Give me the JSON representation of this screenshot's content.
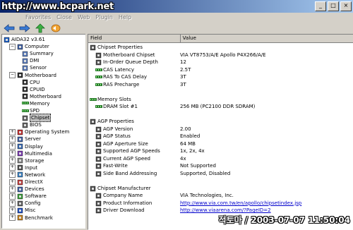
{
  "watermark": "http://www.bcpark.net",
  "menu": [
    "Sc",
    "Favorites",
    "Close",
    "Web",
    "Plugin",
    "Help"
  ],
  "tree": [
    {
      "label": "AIDA32 v3.61",
      "indent": 0,
      "exp": "",
      "icon": "app-icon"
    },
    {
      "label": "Computer",
      "indent": 1,
      "exp": "−",
      "icon": "computer-icon"
    },
    {
      "label": "Summary",
      "indent": 2,
      "exp": "",
      "icon": "summary-icon"
    },
    {
      "label": "DMI",
      "indent": 2,
      "exp": "",
      "icon": "dmi-icon"
    },
    {
      "label": "Sensor",
      "indent": 2,
      "exp": "",
      "icon": "sensor-icon"
    },
    {
      "label": "Motherboard",
      "indent": 1,
      "exp": "−",
      "icon": "motherboard-icon"
    },
    {
      "label": "CPU",
      "indent": 2,
      "exp": "",
      "icon": "cpu-icon"
    },
    {
      "label": "CPUID",
      "indent": 2,
      "exp": "",
      "icon": "cpuid-icon"
    },
    {
      "label": "Motherboard",
      "indent": 2,
      "exp": "",
      "icon": "board-icon"
    },
    {
      "label": "Memory",
      "indent": 2,
      "exp": "",
      "icon": "memory-icon"
    },
    {
      "label": "SPD",
      "indent": 2,
      "exp": "",
      "icon": "spd-icon"
    },
    {
      "label": "Chipset",
      "indent": 2,
      "exp": "",
      "icon": "chipset-icon",
      "selected": true
    },
    {
      "label": "BIOS",
      "indent": 2,
      "exp": "",
      "icon": "bios-icon"
    },
    {
      "label": "Operating System",
      "indent": 1,
      "exp": "+",
      "icon": "os-icon"
    },
    {
      "label": "Server",
      "indent": 1,
      "exp": "+",
      "icon": "server-icon"
    },
    {
      "label": "Display",
      "indent": 1,
      "exp": "+",
      "icon": "display-icon"
    },
    {
      "label": "Multimedia",
      "indent": 1,
      "exp": "+",
      "icon": "multimedia-icon"
    },
    {
      "label": "Storage",
      "indent": 1,
      "exp": "+",
      "icon": "storage-icon"
    },
    {
      "label": "Input",
      "indent": 1,
      "exp": "+",
      "icon": "input-icon"
    },
    {
      "label": "Network",
      "indent": 1,
      "exp": "+",
      "icon": "network-icon"
    },
    {
      "label": "DirectX",
      "indent": 1,
      "exp": "+",
      "icon": "directx-icon"
    },
    {
      "label": "Devices",
      "indent": 1,
      "exp": "+",
      "icon": "devices-icon"
    },
    {
      "label": "Software",
      "indent": 1,
      "exp": "+",
      "icon": "software-icon"
    },
    {
      "label": "Config",
      "indent": 1,
      "exp": "+",
      "icon": "config-icon"
    },
    {
      "label": "Misc",
      "indent": 1,
      "exp": "+",
      "icon": "misc-icon"
    },
    {
      "label": "Benchmark",
      "indent": 1,
      "exp": "+",
      "icon": "benchmark-icon"
    }
  ],
  "columns": {
    "field": "Field",
    "value": "Value"
  },
  "rows": [
    {
      "type": "group",
      "field": "Chipset Properties",
      "value": "",
      "icon": "chipset-group-icon"
    },
    {
      "type": "item",
      "field": "Motherboard Chipset",
      "value": "VIA VT8753/A/E Apollo P4X266/A/E",
      "icon": "chip-icon"
    },
    {
      "type": "item",
      "field": "In-Order Queue Depth",
      "value": "12",
      "icon": "chip-icon"
    },
    {
      "type": "item",
      "field": "CAS Latency",
      "value": "2.5T",
      "icon": "ram-icon"
    },
    {
      "type": "item",
      "field": "RAS To CAS Delay",
      "value": "3T",
      "icon": "ram-icon"
    },
    {
      "type": "item",
      "field": "RAS Precharge",
      "value": "3T",
      "icon": "ram-icon"
    },
    {
      "type": "blank",
      "field": "",
      "value": ""
    },
    {
      "type": "group",
      "field": "Memory Slots",
      "value": "",
      "icon": "ram-icon"
    },
    {
      "type": "item",
      "field": "DRAM Slot #1",
      "value": "256 MB  (PC2100 DDR SDRAM)",
      "icon": "ram-icon"
    },
    {
      "type": "blank",
      "field": "",
      "value": ""
    },
    {
      "type": "group",
      "field": "AGP Properties",
      "value": "",
      "icon": "agp-group-icon"
    },
    {
      "type": "item",
      "field": "AGP Version",
      "value": "2.00",
      "icon": "chip-icon"
    },
    {
      "type": "item",
      "field": "AGP Status",
      "value": "Enabled",
      "icon": "chip-icon"
    },
    {
      "type": "item",
      "field": "AGP Aperture Size",
      "value": "64 MB",
      "icon": "chip-icon"
    },
    {
      "type": "item",
      "field": "Supported AGP Speeds",
      "value": "1x, 2x, 4x",
      "icon": "chip-icon"
    },
    {
      "type": "item",
      "field": "Current AGP Speed",
      "value": "4x",
      "icon": "chip-icon"
    },
    {
      "type": "item",
      "field": "Fast-Write",
      "value": "Not Supported",
      "icon": "chip-icon"
    },
    {
      "type": "item",
      "field": "Side Band Addressing",
      "value": "Supported, Disabled",
      "icon": "chip-icon"
    },
    {
      "type": "blank",
      "field": "",
      "value": ""
    },
    {
      "type": "group",
      "field": "Chipset Manufacturer",
      "value": "",
      "icon": "chipset-group-icon"
    },
    {
      "type": "item",
      "field": "Company Name",
      "value": "VIA Technologies, Inc.",
      "icon": "chip-icon"
    },
    {
      "type": "item",
      "field": "Product Information",
      "value": "http://www.via.com.tw/en/apollo/chipsetindex.jsp",
      "icon": "chip-icon",
      "link": true
    },
    {
      "type": "item",
      "field": "Driver Download",
      "value": "http://www.viaarena.com/?PageID=2",
      "icon": "chip-icon",
      "link": true
    }
  ],
  "overlay_date": "적토마 / 2003-07-07 11:50:04"
}
